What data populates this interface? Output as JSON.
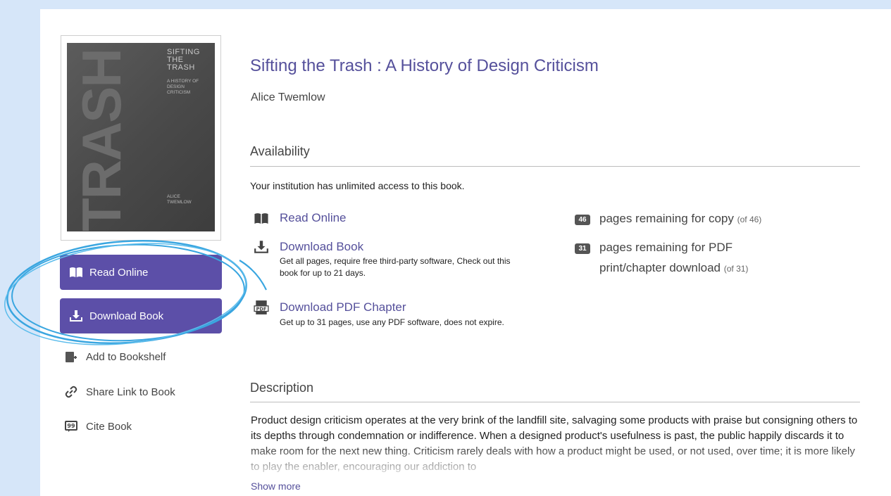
{
  "book": {
    "title": "Sifting the Trash : A History of Design Criticism",
    "author": "Alice Twemlow",
    "cover": {
      "title_lines": [
        "SIFTING",
        "THE",
        "TRASH"
      ],
      "subtitle_lines": [
        "A HISTORY OF",
        "DESIGN",
        "CRITICISM"
      ],
      "big_text": "TRASH",
      "author_lines": [
        "ALICE",
        "TWEMLOW"
      ]
    }
  },
  "sidebar": {
    "read_online_label": "Read Online",
    "download_book_label": "Download Book",
    "links": [
      {
        "label": "Add to Bookshelf",
        "icon": "bookshelf-add-icon"
      },
      {
        "label": "Share Link to Book",
        "icon": "link-icon"
      },
      {
        "label": "Cite Book",
        "icon": "quote-icon"
      }
    ]
  },
  "availability": {
    "heading": "Availability",
    "note": "Your institution has unlimited access to this book.",
    "options": [
      {
        "label": "Read Online",
        "icon": "book-open-icon",
        "desc": ""
      },
      {
        "label": "Download Book",
        "icon": "download-icon",
        "desc": "Get all pages, require free third-party software, Check out this book for up to 21 days."
      },
      {
        "label": "Download PDF Chapter",
        "icon": "pdf-icon",
        "desc": "Get up to 31 pages, use any PDF software, does not expire."
      }
    ],
    "quotas": [
      {
        "count": "46",
        "text": "pages remaining for copy",
        "of": "(of 46)"
      },
      {
        "count": "31",
        "text": "pages remaining for PDF print/chapter download",
        "of": "(of 31)"
      }
    ]
  },
  "description": {
    "heading": "Description",
    "text": "Product design criticism operates at the very brink of the landfill site, salvaging some products with praise but consigning others to its depths through condemnation or indifference. When a designed product's usefulness is past, the public happily discards it to make room for the next new thing. Criticism rarely deals with how a product might be used, or not used, over time; it is more likely to play the enabler, encouraging our addiction to",
    "show_more": "Show more"
  },
  "colors": {
    "background": "#d6e6f9",
    "accent": "#5c4fa8",
    "title": "#55509b",
    "annotation": "#3aa6e0"
  }
}
